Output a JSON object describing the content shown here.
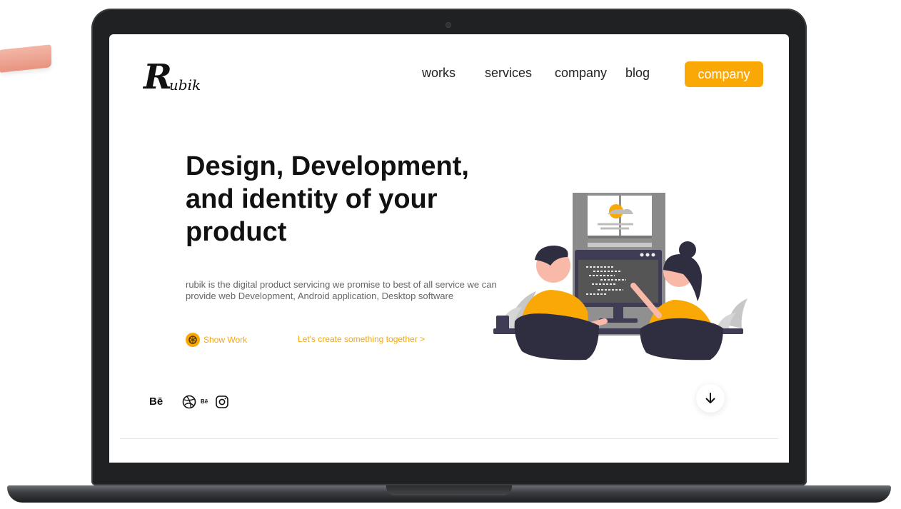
{
  "logo": {
    "initial": "R",
    "rest": "ubik"
  },
  "nav": {
    "works": "works",
    "services": "services",
    "company": "company",
    "blog": "blog"
  },
  "cta": {
    "label": "company"
  },
  "hero": {
    "title": "Design, Development, and identity of your product",
    "description": "rubik is the digital product servicing we promise to best of all service we can provide web Development, Android application, Desktop software",
    "show_work": "Show Work",
    "create_link": "Let's create something together  >"
  },
  "socials": {
    "behance_1": "Bē",
    "behance_2": "Bē"
  },
  "colors": {
    "accent": "#f9a806",
    "dark": "#2f2e41",
    "text": "#111111"
  },
  "icons": [
    "dribbble-icon",
    "instagram-icon",
    "arrow-down-icon",
    "show-work-icon"
  ]
}
